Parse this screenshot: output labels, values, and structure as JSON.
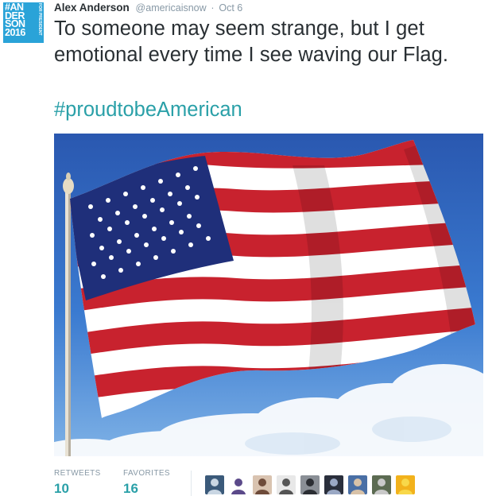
{
  "author": {
    "name": "Alex Anderson",
    "handle": "@americaisnow",
    "separator": "·",
    "date": "Oct 6",
    "avatar_text": "#AN\nDER\nSON\n2016",
    "avatar_side_text": "FOR PRESIDENT"
  },
  "tweet": {
    "text": "To someone may seem strange, but I get emotional every time I see waving our Flag.",
    "hashtag": "#proudtobeAmerican"
  },
  "media": {
    "description_icon": "american-flag-photo"
  },
  "stats": {
    "retweets_label": "RETWEETS",
    "retweets_value": "10",
    "favorites_label": "FAVORITES",
    "favorites_value": "16"
  },
  "likers": [
    {
      "name": "liker-avatar-1",
      "bg": "#3b5a7a",
      "fg": "#c9d6e3"
    },
    {
      "name": "liker-avatar-2",
      "bg": "#ffffff",
      "fg": "#5b4a8a"
    },
    {
      "name": "liker-avatar-3",
      "bg": "#d9c3b0",
      "fg": "#6e4b3a"
    },
    {
      "name": "liker-avatar-4",
      "bg": "#e8e8e8",
      "fg": "#555555"
    },
    {
      "name": "liker-avatar-5",
      "bg": "#8a8f96",
      "fg": "#2b2e33"
    },
    {
      "name": "liker-avatar-6",
      "bg": "#2a2f3c",
      "fg": "#9aa8c4"
    },
    {
      "name": "liker-avatar-7",
      "bg": "#4a6fa5",
      "fg": "#d8c2a8"
    },
    {
      "name": "liker-avatar-8",
      "bg": "#5c6b52",
      "fg": "#c9c9c9"
    },
    {
      "name": "liker-avatar-9",
      "bg": "#f2b21c",
      "fg": "#f8d84a"
    }
  ],
  "colors": {
    "link": "#2aa0a8",
    "muted": "#8899a6",
    "text": "#292f33",
    "avatar_bg": "#2aa3d8"
  }
}
